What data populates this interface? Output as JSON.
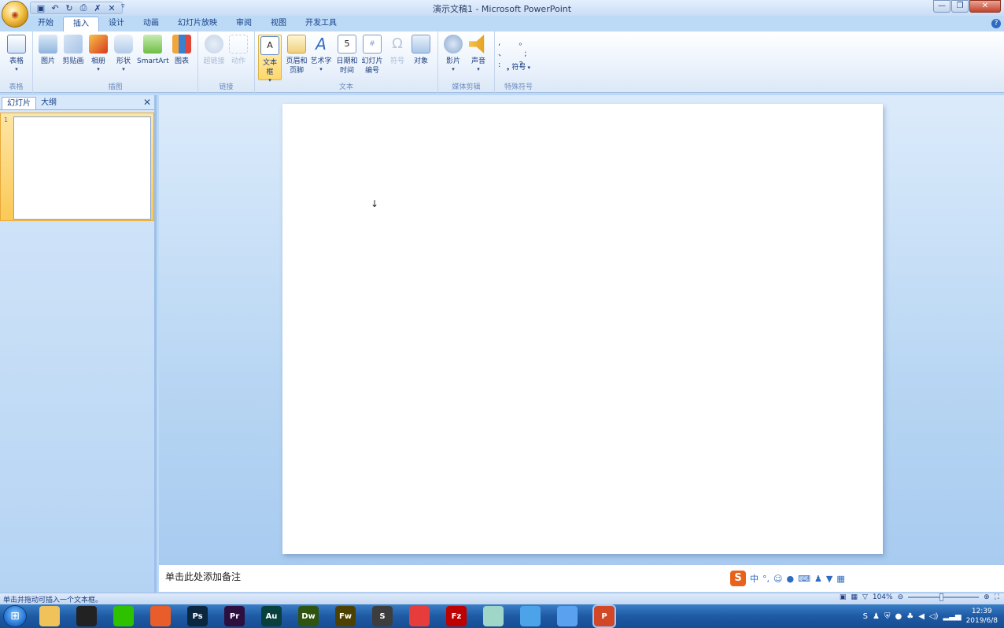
{
  "title_bar": {
    "title": "演示文稿1 - Microsoft PowerPoint",
    "office_button_label": "Office",
    "quick_access": [
      "save-icon",
      "undo-icon",
      "redo-icon",
      "print-preview-icon",
      "spelling-icon",
      "close-doc-icon"
    ],
    "qat_more": "▿",
    "window_controls": {
      "minimize": "—",
      "restore": "❐",
      "close": "✕"
    }
  },
  "tabs": [
    {
      "label": "开始"
    },
    {
      "label": "插入",
      "active": true
    },
    {
      "label": "设计"
    },
    {
      "label": "动画"
    },
    {
      "label": "幻灯片放映"
    },
    {
      "label": "审阅"
    },
    {
      "label": "视图"
    },
    {
      "label": "开发工具"
    }
  ],
  "ribbon": {
    "groups": {
      "tables": "表格",
      "illustrations": "插图",
      "links": "链接",
      "text": "文本",
      "media": "媒体剪辑",
      "special": "特殊符号"
    },
    "buttons": {
      "table": "表格",
      "picture": "图片",
      "clipart": "剪贴画",
      "album": "相册",
      "shapes": "形状",
      "smartart": "SmartArt",
      "chart": "图表",
      "hyperlink": "超链接",
      "action": "动作",
      "textbox": "文本框",
      "header_footer_1": "页眉和",
      "header_footer_2": "页脚",
      "wordart": "艺术字",
      "datetime_1": "日期和",
      "datetime_2": "时间",
      "slide_number_1": "幻灯片",
      "slide_number_2": "编号",
      "symbol": "符号",
      "object": "对象",
      "movie": "影片",
      "sound": "声音",
      "special_symbol": "符号"
    },
    "symbol_glyphs": ", 。 、 ; : ?"
  },
  "left_pane": {
    "tabs": [
      "幻灯片",
      "大纲"
    ],
    "close": "✕",
    "slide_number": "1"
  },
  "main": {
    "cursor_glyph": "↓"
  },
  "notes": {
    "placeholder": "单击此处添加备注"
  },
  "ime": {
    "logo": "S",
    "mode": "中",
    "punct": "°,",
    "icons": [
      "emoji-icon",
      "mic-icon",
      "keyboard-icon",
      "user-icon",
      "shirt-icon",
      "grid-icon"
    ]
  },
  "status_bar": {
    "message": "单击并拖动可插入一个文本框。",
    "zoom": "104%"
  },
  "taskbar": {
    "apps": [
      {
        "name": "file-explorer-icon",
        "label": "",
        "color": "#f0c35a"
      },
      {
        "name": "qq-icon",
        "label": "",
        "color": "#222222"
      },
      {
        "name": "wechat-icon",
        "label": "",
        "color": "#2dc100"
      },
      {
        "name": "browser-icon",
        "label": "",
        "color": "#e95d2a"
      },
      {
        "name": "photoshop-icon",
        "label": "Ps",
        "color": "#0b2740"
      },
      {
        "name": "premiere-icon",
        "label": "Pr",
        "color": "#2c0f3f"
      },
      {
        "name": "audition-icon",
        "label": "Au",
        "color": "#08403c"
      },
      {
        "name": "dreamweaver-icon",
        "label": "Dw",
        "color": "#2e5410"
      },
      {
        "name": "fireworks-icon",
        "label": "Fw",
        "color": "#4d4102"
      },
      {
        "name": "sublime-icon",
        "label": "S",
        "color": "#3d3d3d"
      },
      {
        "name": "colorful-app-icon",
        "label": "",
        "color": "#e63c3c"
      },
      {
        "name": "filezilla-icon",
        "label": "Fz",
        "color": "#bf0000"
      },
      {
        "name": "notes-app-icon",
        "label": "",
        "color": "#9fd6c8"
      },
      {
        "name": "feishu-icon",
        "label": "",
        "color": "#4ca3e8"
      },
      {
        "name": "baidu-netdisk-icon",
        "label": "",
        "color": "#5aa2f0"
      },
      {
        "name": "powerpoint-icon",
        "label": "P",
        "color": "#d24726",
        "active": true
      }
    ],
    "clock_time": "12:39",
    "clock_date": "2019/6/8"
  }
}
